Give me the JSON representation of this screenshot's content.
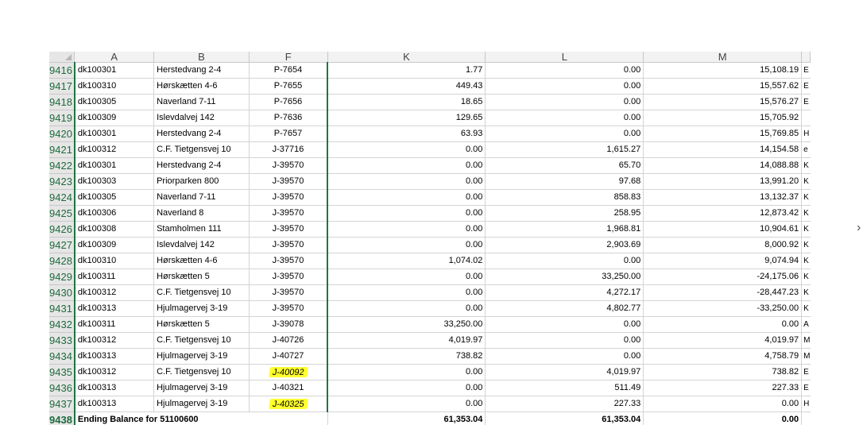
{
  "columns": [
    "A",
    "B",
    "F",
    "K",
    "L",
    "M"
  ],
  "rows": [
    {
      "row": "9416",
      "a": "dk100301",
      "b": "Herstedvang 2-4",
      "f": "P-7654",
      "k": "1.77",
      "l": "0.00",
      "m": "15,108.19",
      "n": "E"
    },
    {
      "row": "9417",
      "a": "dk100310",
      "b": "Hørskætten 4-6",
      "f": "P-7655",
      "k": "449.43",
      "l": "0.00",
      "m": "15,557.62",
      "n": "E"
    },
    {
      "row": "9418",
      "a": "dk100305",
      "b": "Naverland 7-11",
      "f": "P-7656",
      "k": "18.65",
      "l": "0.00",
      "m": "15,576.27",
      "n": "E"
    },
    {
      "row": "9419",
      "a": "dk100309",
      "b": "Islevdalvej 142",
      "f": "P-7636",
      "k": "129.65",
      "l": "0.00",
      "m": "15,705.92",
      "n": ""
    },
    {
      "row": "9420",
      "a": "dk100301",
      "b": "Herstedvang 2-4",
      "f": "P-7657",
      "k": "63.93",
      "l": "0.00",
      "m": "15,769.85",
      "n": "H"
    },
    {
      "row": "9421",
      "a": "dk100312",
      "b": "C.F. Tietgensvej 10",
      "f": "J-37716",
      "k": "0.00",
      "l": "1,615.27",
      "m": "14,154.58",
      "n": "e"
    },
    {
      "row": "9422",
      "a": "dk100301",
      "b": "Herstedvang 2-4",
      "f": "J-39570",
      "k": "0.00",
      "l": "65.70",
      "m": "14,088.88",
      "n": "K"
    },
    {
      "row": "9423",
      "a": "dk100303",
      "b": "Priorparken 800",
      "f": "J-39570",
      "k": "0.00",
      "l": "97.68",
      "m": "13,991.20",
      "n": "K"
    },
    {
      "row": "9424",
      "a": "dk100305",
      "b": "Naverland 7-11",
      "f": "J-39570",
      "k": "0.00",
      "l": "858.83",
      "m": "13,132.37",
      "n": "K"
    },
    {
      "row": "9425",
      "a": "dk100306",
      "b": "Naverland 8",
      "f": "J-39570",
      "k": "0.00",
      "l": "258.95",
      "m": "12,873.42",
      "n": "K"
    },
    {
      "row": "9426",
      "a": "dk100308",
      "b": "Stamholmen 111",
      "f": "J-39570",
      "k": "0.00",
      "l": "1,968.81",
      "m": "10,904.61",
      "n": "K"
    },
    {
      "row": "9427",
      "a": "dk100309",
      "b": "Islevdalvej 142",
      "f": "J-39570",
      "k": "0.00",
      "l": "2,903.69",
      "m": "8,000.92",
      "n": "K"
    },
    {
      "row": "9428",
      "a": "dk100310",
      "b": "Hørskætten 4-6",
      "f": "J-39570",
      "k": "1,074.02",
      "l": "0.00",
      "m": "9,074.94",
      "n": "K"
    },
    {
      "row": "9429",
      "a": "dk100311",
      "b": "Hørskætten 5",
      "f": "J-39570",
      "k": "0.00",
      "l": "33,250.00",
      "m": "-24,175.06",
      "n": "K"
    },
    {
      "row": "9430",
      "a": "dk100312",
      "b": "C.F. Tietgensvej 10",
      "f": "J-39570",
      "k": "0.00",
      "l": "4,272.17",
      "m": "-28,447.23",
      "n": "K"
    },
    {
      "row": "9431",
      "a": "dk100313",
      "b": "Hjulmagervej 3-19",
      "f": "J-39570",
      "k": "0.00",
      "l": "4,802.77",
      "m": "-33,250.00",
      "n": "K"
    },
    {
      "row": "9432",
      "a": "dk100311",
      "b": "Hørskætten 5",
      "f": "J-39078",
      "k": "33,250.00",
      "l": "0.00",
      "m": "0.00",
      "n": "A"
    },
    {
      "row": "9433",
      "a": "dk100312",
      "b": "C.F. Tietgensvej 10",
      "f": "J-40726",
      "k": "4,019.97",
      "l": "0.00",
      "m": "4,019.97",
      "n": "M"
    },
    {
      "row": "9434",
      "a": "dk100313",
      "b": "Hjulmagervej 3-19",
      "f": "J-40727",
      "k": "738.82",
      "l": "0.00",
      "m": "4,758.79",
      "n": "M"
    },
    {
      "row": "9435",
      "a": "dk100312",
      "b": "C.F. Tietgensvej 10",
      "f": "J-40092",
      "k": "0.00",
      "l": "4,019.97",
      "m": "738.82",
      "n": "E",
      "highlight": true
    },
    {
      "row": "9436",
      "a": "dk100313",
      "b": "Hjulmagervej 3-19",
      "f": "J-40321",
      "k": "0.00",
      "l": "511.49",
      "m": "227.33",
      "n": "E"
    },
    {
      "row": "9437",
      "a": "dk100313",
      "b": "Hjulmagervej 3-19",
      "f": "J-40325",
      "k": "0.00",
      "l": "227.33",
      "m": "0.00",
      "n": "H",
      "highlight": true
    }
  ],
  "final_row": {
    "row": "9438",
    "label": "Ending Balance for 51100600",
    "k": "61,353.04",
    "l": "61,353.04",
    "m": "0.00"
  },
  "highlight_color": "#ffff2e",
  "header_accent": "#217346",
  "right_edge_glyph": "›"
}
